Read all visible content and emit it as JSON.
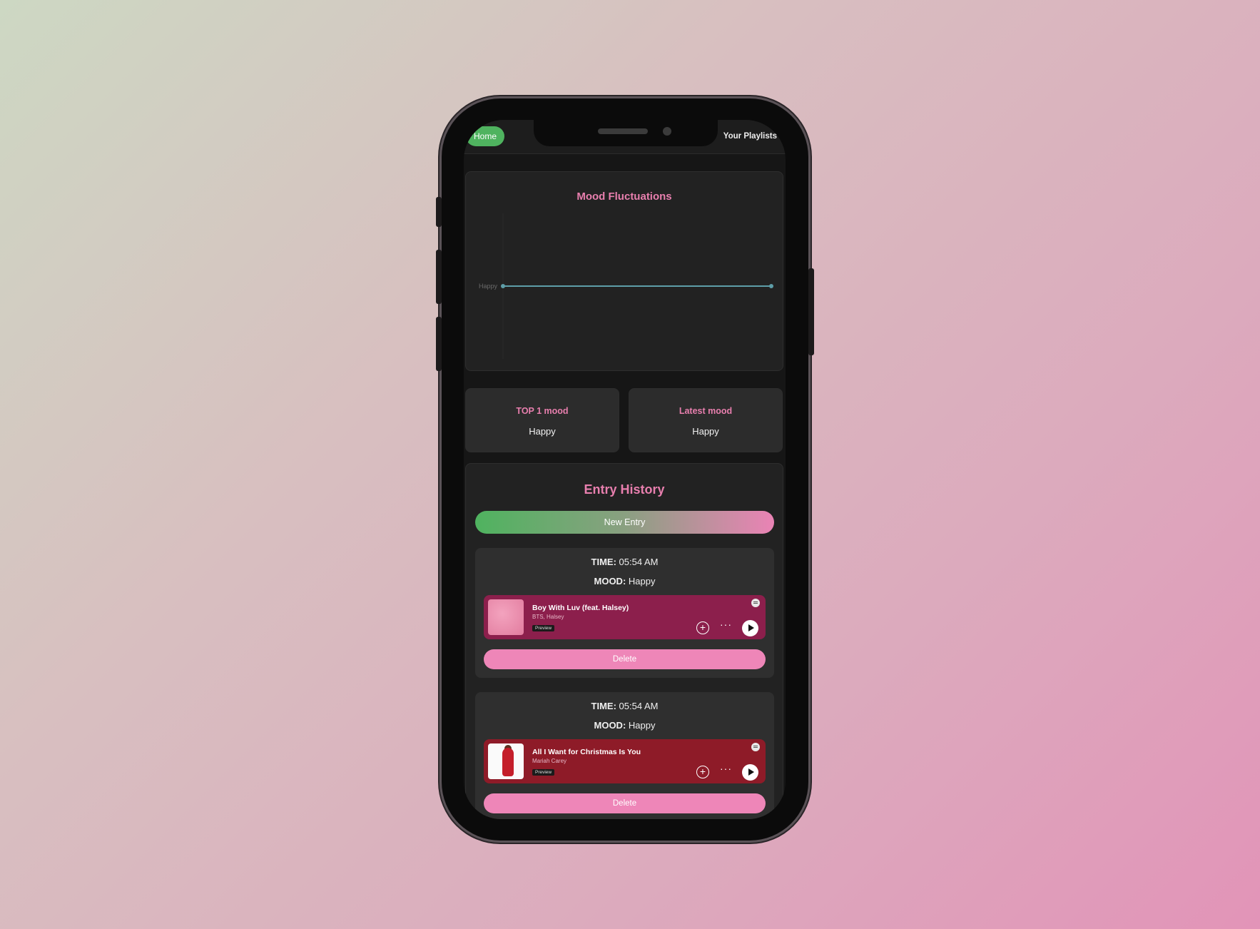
{
  "nav": {
    "home_label": "Home",
    "playlists_label": "Your Playlists"
  },
  "mood_chart": {
    "title": "Mood Fluctuations",
    "y_label": "Happy",
    "line_color": "#5e9ea8"
  },
  "chart_data": {
    "type": "line",
    "title": "Mood Fluctuations",
    "y_categories": [
      "Happy"
    ],
    "series": [
      {
        "values": [
          "Happy",
          "Happy"
        ]
      }
    ],
    "grid": false
  },
  "stats": {
    "top_label": "TOP 1 mood",
    "top_value": "Happy",
    "latest_label": "Latest mood",
    "latest_value": "Happy"
  },
  "history": {
    "title": "Entry History",
    "new_entry_label": "New Entry",
    "entries": [
      {
        "time_label": "TIME:",
        "time_value": "05:54 AM",
        "mood_label": "MOOD:",
        "mood_value": "Happy",
        "track_title": "Boy With Luv (feat. Halsey)",
        "track_artist": "BTS, Halsey",
        "preview_label": "Preview",
        "delete_label": "Delete"
      },
      {
        "time_label": "TIME:",
        "time_value": "05:54 AM",
        "mood_label": "MOOD:",
        "mood_value": "Happy",
        "track_title": "All I Want for Christmas Is You",
        "track_artist": "Mariah Carey",
        "preview_label": "Preview",
        "delete_label": "Delete"
      }
    ]
  },
  "colors": {
    "accent_pink": "#e87fae",
    "accent_green": "#4fb35f"
  },
  "icons": [
    "plus-circle-icon",
    "more-dots-icon",
    "play-icon",
    "spotify-icon"
  ]
}
